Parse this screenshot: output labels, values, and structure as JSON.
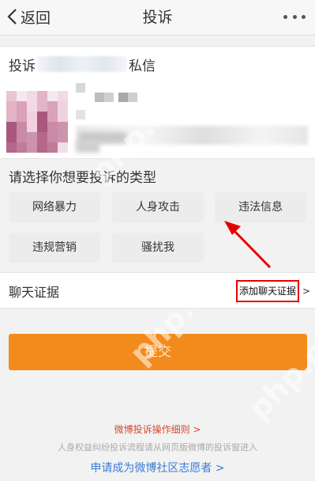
{
  "header": {
    "back_label": "返回",
    "title": "投诉"
  },
  "target": {
    "prefix": "投诉",
    "suffix": "私信"
  },
  "types": {
    "title": "请选择你想要投诉的类型",
    "items": [
      "网络暴力",
      "人身攻击",
      "违法信息",
      "违规营销",
      "骚扰我"
    ]
  },
  "chat": {
    "label": "聊天证据",
    "add_label": "添加聊天证据",
    "add_chevron": ">"
  },
  "submit_label": "提交",
  "footer": {
    "detail_link": "微博投诉操作细则 >",
    "note": "人身权益纠纷投诉流程请从网页版微博的投诉窗进入",
    "volunteer_link": "申请成为微博社区志愿者 >"
  },
  "watermark": "php.cn",
  "colors": {
    "submit": "#f28b1b",
    "highlight_border": "#e60000",
    "link_red": "#d84a2a",
    "link_blue": "#3a7bd5",
    "arrow": "#e60000"
  }
}
